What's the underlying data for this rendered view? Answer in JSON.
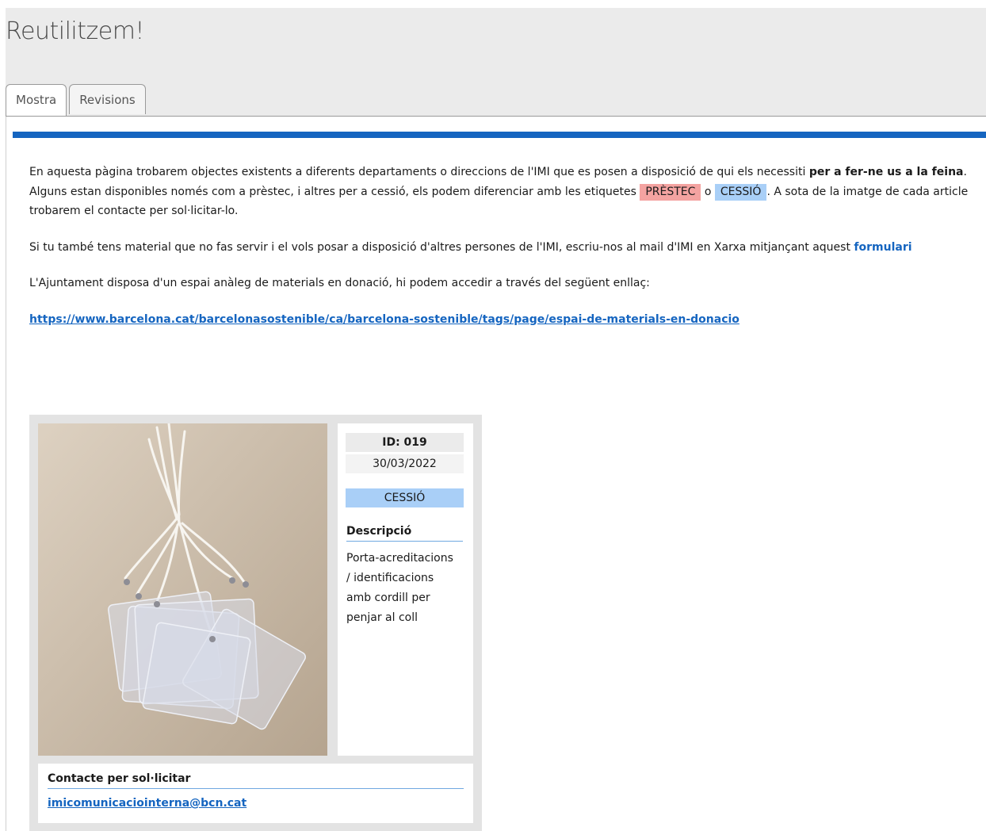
{
  "page": {
    "title": "Reutilitzem!"
  },
  "tabs": [
    {
      "label": "Mostra",
      "active": true
    },
    {
      "label": "Revisions",
      "active": false
    }
  ],
  "intro": {
    "p1_a": "En aquesta pàgina trobarem objectes existents a diferents departaments o direccions de l'IMI que es posen  a disposició de qui els necessiti ",
    "p1_bold": "per a fer-ne us a la feina",
    "p1_b": ". Alguns estan disponibles només com a prèstec, i altres per a cessió, els podem diferenciar amb les etiquetes ",
    "label_prestec": "PRÈSTEC",
    "p1_o": " o ",
    "label_cessio": "CESSIÓ",
    "p1_c": ". A sota de la imatge de cada article trobarem el contacte per sol·licitar-lo.",
    "p2": "Si tu també tens material que no fas servir i el vols posar a disposició d'altres persones de l'IMI, escriu-nos al mail d'IMI en Xarxa mitjançant aquest ",
    "p2_link": "formulari",
    "p3": "L'Ajuntament disposa d'un espai anàleg de materials en donació, hi podem accedir a través del següent enllaç:",
    "url": "https://www.barcelona.cat/barcelonasostenible/ca/barcelona-sostenible/tags/page/espai-de-materials-en-donacio"
  },
  "item": {
    "id_label": "ID: 019",
    "date": "30/03/2022",
    "type": "CESSIÓ",
    "desc_heading": "Descripció",
    "description": "Porta-acreditacions / identificacions amb cordill per penjar al coll",
    "contact_heading": "Contacte per sol·licitar",
    "contact_email": "imicomunicaciointerna@bcn.cat",
    "photo_icon": "badge-holders-photo"
  },
  "colors": {
    "accent_blue": "#1565c0",
    "label_prestec": "#f4a3a1",
    "label_cessio": "#a9cff7"
  }
}
